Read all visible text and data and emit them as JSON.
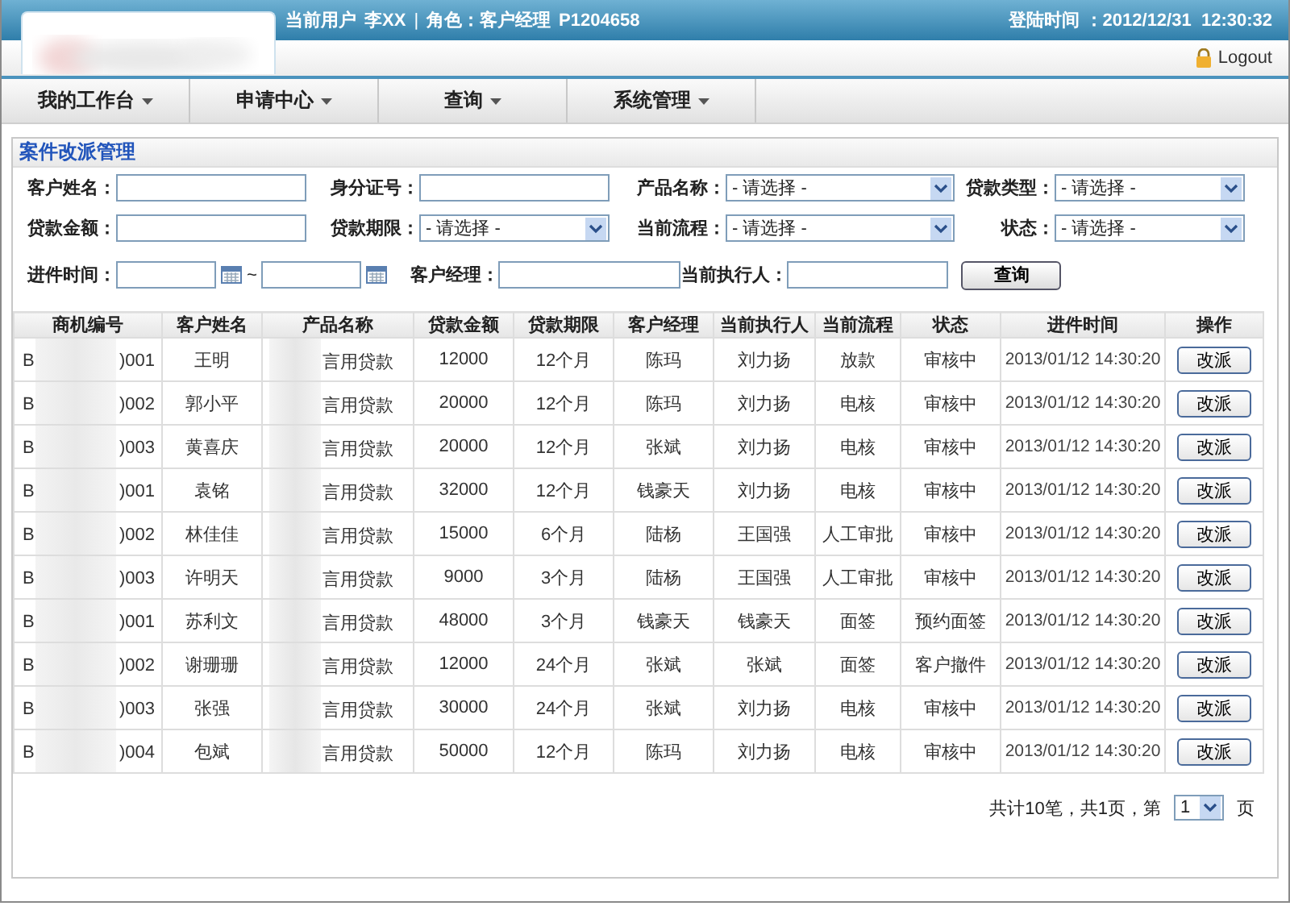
{
  "header": {
    "user_label": "当前用户",
    "user": "李XX",
    "separator": "|",
    "role": "角色：客户经理",
    "code": "P1204658",
    "login_time": "登陆时间 ：2012/12/31  12:30:32"
  },
  "logout": "Logout",
  "nav": [
    {
      "label": "我的工作台"
    },
    {
      "label": "申请中心"
    },
    {
      "label": "查询"
    },
    {
      "label": "系统管理"
    }
  ],
  "panel_title": "案件改派管理",
  "filter_rows": [
    [
      {
        "label": "客户姓名：",
        "kind": "text"
      },
      {
        "label": "身分证号：",
        "kind": "text"
      },
      {
        "label": "产品名称：",
        "kind": "select",
        "value": "- 请选择  -"
      },
      {
        "label": "贷款类型：",
        "kind": "select",
        "value": "- 请选择  -"
      }
    ],
    [
      {
        "label": "贷款金额：",
        "kind": "text"
      },
      {
        "label": "贷款期限：",
        "kind": "select",
        "value": "- 请选择  -"
      },
      {
        "label": "当前流程：",
        "kind": "select",
        "value": "- 请选择  -"
      },
      {
        "label": "状态：",
        "kind": "select",
        "value": "- 请选择  -"
      }
    ]
  ],
  "date_filter": {
    "label": "进件时间：",
    "separator": "~"
  },
  "manager_filter": {
    "label": "客户经理："
  },
  "executor_filter": {
    "label": "当前执行人："
  },
  "search_button": "查询",
  "table": {
    "columns": [
      "商机编号",
      "客户姓名",
      "产品名称",
      "贷款金额",
      "贷款期限",
      "客户经理",
      "当前执行人",
      "当前流程",
      "状态",
      "进件时间",
      "操作"
    ],
    "rows": [
      {
        "id_start": "B",
        "id_end": ")001",
        "name": "王明",
        "product": "言用贷款",
        "amount": "12000",
        "term": "12个月",
        "manager": "陈玛",
        "executor": "刘力扬",
        "stage": "放款",
        "status": "审核中",
        "time": "2013/01/12 14:30:20",
        "action": "改派"
      },
      {
        "id_start": "B",
        "id_end": ")002",
        "name": "郭小平",
        "product": "言用贷款",
        "amount": "20000",
        "term": "12个月",
        "manager": "陈玛",
        "executor": "刘力扬",
        "stage": "电核",
        "status": "审核中",
        "time": "2013/01/12 14:30:20",
        "action": "改派"
      },
      {
        "id_start": "B",
        "id_end": ")003",
        "name": "黄喜庆",
        "product": "言用贷款",
        "amount": "20000",
        "term": "12个月",
        "manager": "张斌",
        "executor": "刘力扬",
        "stage": "电核",
        "status": "审核中",
        "time": "2013/01/12 14:30:20",
        "action": "改派"
      },
      {
        "id_start": "B",
        "id_end": ")001",
        "name": "袁铭",
        "product": "言用贷款",
        "amount": "32000",
        "term": "12个月",
        "manager": "钱豪天",
        "executor": "刘力扬",
        "stage": "电核",
        "status": "审核中",
        "time": "2013/01/12 14:30:20",
        "action": "改派"
      },
      {
        "id_start": "B",
        "id_end": ")002",
        "name": "林佳佳",
        "product": "言用贷款",
        "amount": "15000",
        "term": "6个月",
        "manager": "陆杨",
        "executor": "王国强",
        "stage": "人工审批",
        "status": "审核中",
        "time": "2013/01/12 14:30:20",
        "action": "改派"
      },
      {
        "id_start": "B",
        "id_end": ")003",
        "name": "许明天",
        "product": "言用贷款",
        "amount": "9000",
        "term": "3个月",
        "manager": "陆杨",
        "executor": "王国强",
        "stage": "人工审批",
        "status": "审核中",
        "time": "2013/01/12 14:30:20",
        "action": "改派"
      },
      {
        "id_start": "B",
        "id_end": ")001",
        "name": "苏利文",
        "product": "言用贷款",
        "amount": "48000",
        "term": "3个月",
        "manager": "钱豪天",
        "executor": "钱豪天",
        "stage": "面签",
        "status": "预约面签",
        "time": "2013/01/12 14:30:20",
        "action": "改派"
      },
      {
        "id_start": "B",
        "id_end": ")002",
        "name": "谢珊珊",
        "product": "言用贷款",
        "amount": "12000",
        "term": "24个月",
        "manager": "张斌",
        "executor": "张斌",
        "stage": "面签",
        "status": "客户撤件",
        "time": "2013/01/12 14:30:20",
        "action": "改派"
      },
      {
        "id_start": "B",
        "id_end": ")003",
        "name": "张强",
        "product": "言用贷款",
        "amount": "30000",
        "term": "24个月",
        "manager": "张斌",
        "executor": "刘力扬",
        "stage": "电核",
        "status": "审核中",
        "time": "2013/01/12 14:30:20",
        "action": "改派"
      },
      {
        "id_start": "B",
        "id_end": ")004",
        "name": "包斌",
        "product": "言用贷款",
        "amount": "50000",
        "term": "12个月",
        "manager": "陈玛",
        "executor": "刘力扬",
        "stage": "电核",
        "status": "审核中",
        "time": "2013/01/12 14:30:20",
        "action": "改派"
      }
    ]
  },
  "pagination": {
    "summary": "共计10笔，共1页，第",
    "page": "1",
    "suffix": "页"
  }
}
